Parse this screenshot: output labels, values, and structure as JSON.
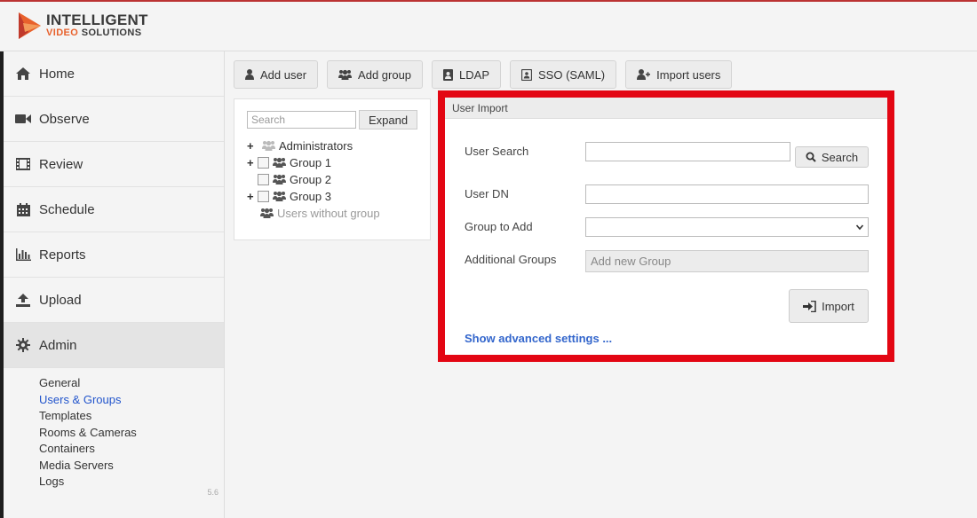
{
  "brand": {
    "line1": "INTELLIGENT",
    "line2_word1": "VIDEO",
    "line2_word2": "SOLUTIONS",
    "colors": {
      "accent_orange": "#e8612c",
      "accent_red": "#c62828",
      "text_dark": "#3a3a3a"
    }
  },
  "sidebar": {
    "items": [
      {
        "label": "Home",
        "icon": "home-icon"
      },
      {
        "label": "Observe",
        "icon": "video-camera-icon"
      },
      {
        "label": "Review",
        "icon": "film-icon"
      },
      {
        "label": "Schedule",
        "icon": "calendar-icon"
      },
      {
        "label": "Reports",
        "icon": "bar-chart-icon"
      },
      {
        "label": "Upload",
        "icon": "upload-icon"
      },
      {
        "label": "Admin",
        "icon": "gear-icon",
        "active": true
      }
    ],
    "admin_subitems": [
      "General",
      "Users & Groups",
      "Templates",
      "Rooms & Cameras",
      "Containers",
      "Media Servers",
      "Logs"
    ],
    "active_subitem": "Users & Groups",
    "version": "5.6"
  },
  "toolbar": {
    "buttons": [
      {
        "label": "Add user",
        "icon": "user-icon"
      },
      {
        "label": "Add group",
        "icon": "users-icon"
      },
      {
        "label": "LDAP",
        "icon": "address-book-icon"
      },
      {
        "label": "SSO (SAML)",
        "icon": "id-card-icon"
      },
      {
        "label": "Import users",
        "icon": "user-plus-icon"
      }
    ]
  },
  "tree": {
    "search_placeholder": "Search",
    "expand_label": "Expand",
    "nodes": [
      {
        "label": "Administrators",
        "expandable": true,
        "checkbox": false,
        "muted_icon": true
      },
      {
        "label": "Group 1",
        "expandable": true,
        "checkbox": true
      },
      {
        "label": "Group 2",
        "expandable": false,
        "checkbox": true
      },
      {
        "label": "Group 3",
        "expandable": true,
        "checkbox": true
      },
      {
        "label": "Users without group",
        "expandable": false,
        "checkbox": false,
        "muted": true
      }
    ]
  },
  "import_panel": {
    "title": "User Import",
    "user_search_label": "User Search",
    "user_search_value": "",
    "search_button": "Search",
    "user_dn_label": "User DN",
    "user_dn_value": "",
    "group_label": "Group to Add",
    "group_value": "",
    "additional_label": "Additional Groups",
    "additional_placeholder": "Add new Group",
    "import_button": "Import",
    "advanced_link": "Show advanced settings ...",
    "highlight_color": "#e30613"
  }
}
